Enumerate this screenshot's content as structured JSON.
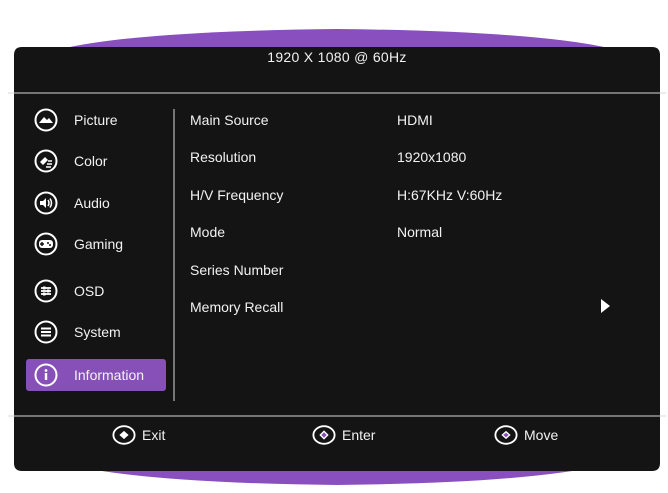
{
  "header": {
    "title": "1920  X  1080  @  60Hz"
  },
  "menu": {
    "items": [
      {
        "label": "Picture",
        "icon": "picture-icon"
      },
      {
        "label": "Color",
        "icon": "color-icon"
      },
      {
        "label": "Audio",
        "icon": "audio-icon"
      },
      {
        "label": "Gaming",
        "icon": "gaming-icon"
      },
      {
        "label": "OSD",
        "icon": "osd-icon"
      },
      {
        "label": "System",
        "icon": "system-icon"
      },
      {
        "label": "Information",
        "icon": "information-icon"
      }
    ],
    "active_index": 6
  },
  "info": {
    "rows": [
      {
        "key": "Main Source",
        "value": "HDMI"
      },
      {
        "key": "Resolution",
        "value": "1920x1080"
      },
      {
        "key": "H/V Frequency",
        "value": "H:67KHz  V:60Hz"
      },
      {
        "key": "Mode",
        "value": "Normal"
      },
      {
        "key": "Series Number",
        "value": ""
      },
      {
        "key": "Memory Recall",
        "value": ""
      }
    ]
  },
  "footer": {
    "exit_label": "Exit",
    "enter_label": "Enter",
    "move_label": "Move"
  },
  "colors": {
    "background": "#141414",
    "accent": "#8750b8",
    "divider": "#ffffff"
  }
}
